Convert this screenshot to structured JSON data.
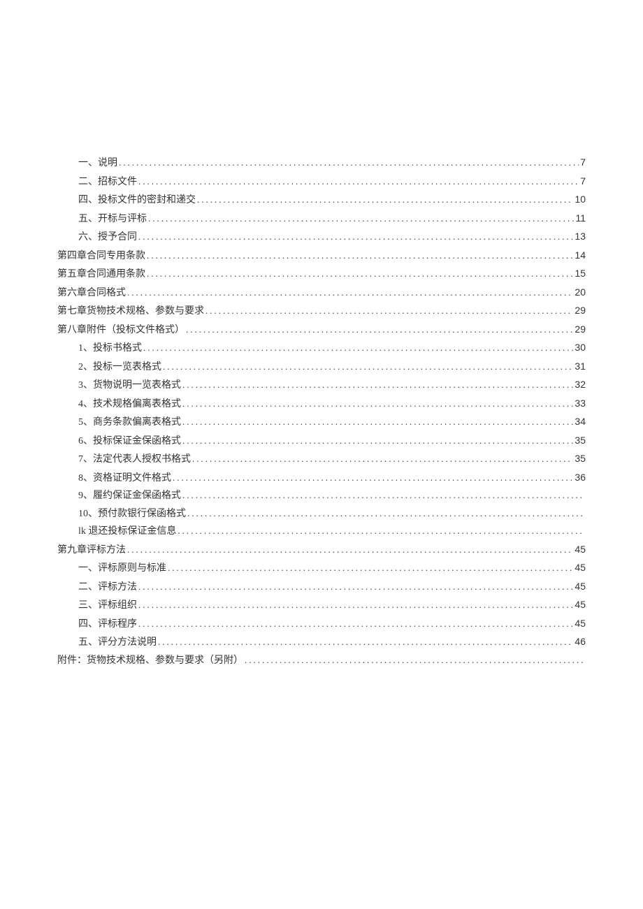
{
  "toc": [
    {
      "level": 2,
      "label": "一、说明",
      "page": "7"
    },
    {
      "level": 2,
      "label": "二、招标文件",
      "page": "7"
    },
    {
      "level": 2,
      "label": "四、投标文件的密封和递交",
      "page": "10"
    },
    {
      "level": 2,
      "label": "五、开标与评标",
      "page": "11"
    },
    {
      "level": 2,
      "label": "六、授予合同",
      "page": "13"
    },
    {
      "level": 1,
      "label": "第四章合同专用条款",
      "page": "14"
    },
    {
      "level": 1,
      "label": "第五章合同通用条款",
      "page": "15"
    },
    {
      "level": 1,
      "label": "第六章合同格式",
      "page": "20"
    },
    {
      "level": 1,
      "label": "第七章货物技术规格、参数与要求",
      "page": "29"
    },
    {
      "level": 1,
      "label": "第八章附件（投标文件格式）",
      "page": "29"
    },
    {
      "level": 2,
      "label": "1、投标书格式",
      "page": "30"
    },
    {
      "level": 2,
      "label": "2、投标一览表格式",
      "page": "31"
    },
    {
      "level": 2,
      "label": "3、货物说明一览表格式",
      "page": "32"
    },
    {
      "level": 2,
      "label": "4、技术规格偏离表格式",
      "page": "33"
    },
    {
      "level": 2,
      "label": "5、商务条款偏离表格式",
      "page": "34"
    },
    {
      "level": 2,
      "label": "6、投标保证金保函格式",
      "page": "35"
    },
    {
      "level": 2,
      "label": "7、法定代表人授权书格式",
      "page": "35"
    },
    {
      "level": 2,
      "label": "8、资格证明文件格式",
      "page": "36"
    },
    {
      "level": 2,
      "label": "9、履约保证金保函格式",
      "page": ""
    },
    {
      "level": 2,
      "label": "10、预付款银行保函格式",
      "page": ""
    },
    {
      "level": 2,
      "label": "lk 退还投标保证金信息",
      "page": ""
    },
    {
      "level": 1,
      "label": "第九章评标方法",
      "page": "45"
    },
    {
      "level": 2,
      "label": "一、评标原则与标准",
      "page": "45"
    },
    {
      "level": 2,
      "label": "二、评标方法",
      "page": "45"
    },
    {
      "level": 2,
      "label": "三、评标组织",
      "page": "45"
    },
    {
      "level": 2,
      "label": "四、评标程序",
      "page": "45"
    },
    {
      "level": 2,
      "label": "五、评分方法说明",
      "page": "46"
    },
    {
      "level": 1,
      "label": "附件：货物技术规格、参数与要求（另附）",
      "page": ""
    }
  ]
}
